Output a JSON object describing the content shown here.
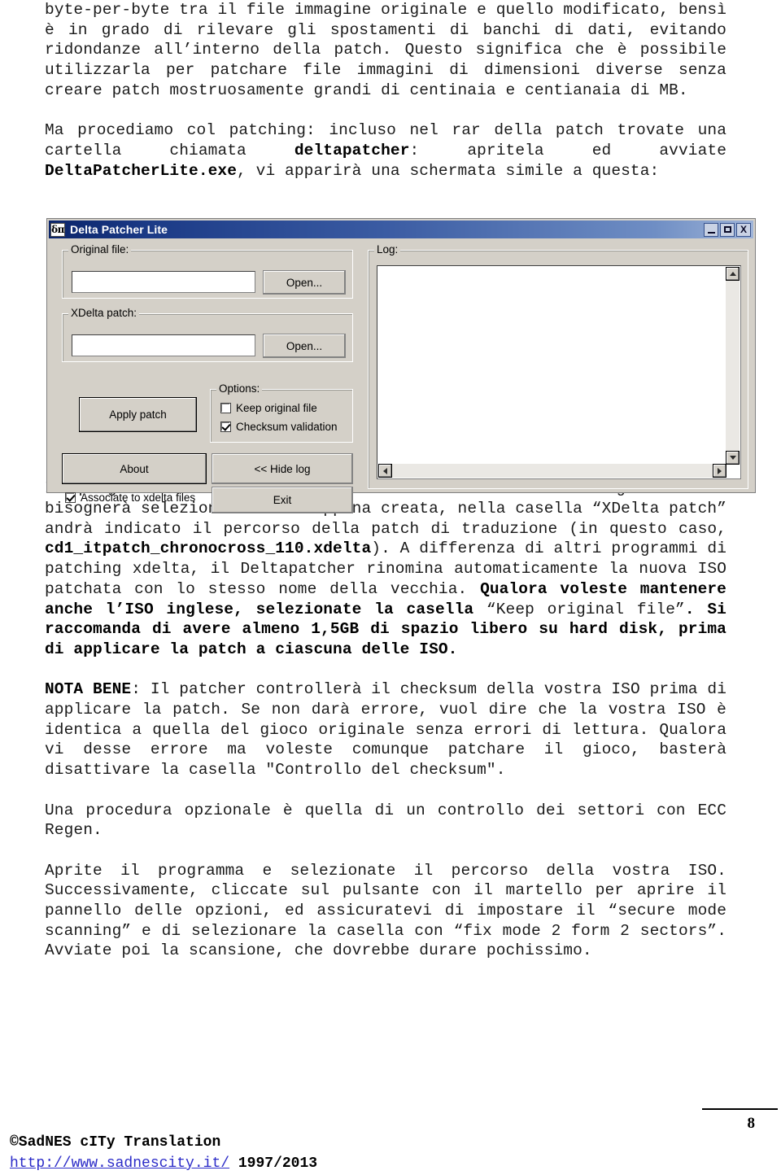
{
  "document": {
    "paragraphs": [
      {
        "id": "p1",
        "runs": [
          {
            "t": "byte-per-byte tra il file immagine originale e quello modificato, bensì è in grado di rilevare gli spostamenti di banchi di dati, evitando ridondanze all’interno della patch. Questo significa che è possibile utilizzarla per patchare file immagini di dimensioni diverse senza creare patch mostruosamente grandi di centinaia e centianaia di MB.",
            "b": false
          }
        ]
      },
      {
        "id": "p2",
        "runs": [
          {
            "t": "Ma procediamo col patching: incluso nel rar della patch trovate una cartella chiamata ",
            "b": false
          },
          {
            "t": "deltapatcher",
            "b": true
          },
          {
            "t": ": apritela ed avviate ",
            "b": false
          },
          {
            "t": "DeltaPatcherLite.exe",
            "b": true
          },
          {
            "t": ", vi apparirà una schermata simile a questa:",
            "b": false
          }
        ]
      },
      {
        "id": "p3",
        "runs": [
          {
            "t": "Il programma è decisamente intuitivo. Mella casella “Original File” bisognerà selezionare l’ISO appena creata, nella casella “XDelta patch” andrà indicato il percorso della patch di traduzione (in questo caso, ",
            "b": false
          },
          {
            "t": "cd1_itpatch_chronocross_110.xdelta",
            "b": true
          },
          {
            "t": "). A differenza di altri programmi di patching xdelta, il Deltapatcher rinomina automaticamente la nuova ISO patchata con lo stesso nome della vecchia. ",
            "b": false
          },
          {
            "t": "Qualora voleste mantenere anche l’ISO inglese, selezionate la casella ",
            "b": true
          },
          {
            "t": "“Keep original file”",
            "b": false
          },
          {
            "t": ". Si raccomanda di avere almeno 1,5GB di spazio libero su hard disk, prima di applicare la patch a ciascuna delle ISO.",
            "b": true
          }
        ]
      },
      {
        "id": "p4",
        "runs": [
          {
            "t": "NOTA BENE",
            "b": true
          },
          {
            "t": ": Il patcher controllerà il checksum della vostra ISO prima di applicare la patch. Se non darà errore, vuol dire che la vostra ISO è identica a quella del gioco originale senza errori di lettura. Qualora vi desse errore ma voleste comunque patchare il gioco, basterà disattivare la casella \"Controllo del checksum\".",
            "b": false
          }
        ]
      },
      {
        "id": "p5",
        "runs": [
          {
            "t": "Una procedura opzionale è quella di un controllo dei settori con ECC Regen.",
            "b": false
          }
        ]
      },
      {
        "id": "p6",
        "runs": [
          {
            "t": "Aprite il programma e selezionate il percorso della vostra ISO. Successivamente, cliccate sul pulsante con il martello per aprire il pannello delle opzioni, ed assicuratevi di impostare il “secure mode scanning” e di selezionare la casella con “fix mode 2 form 2 sectors”. Avviate poi la scansione, che dovrebbe durare pochissimo.",
            "b": false
          }
        ]
      }
    ]
  },
  "app": {
    "icon_glyph": "δπ",
    "title": "Delta Patcher Lite",
    "window_buttons": {
      "minimize_label": "_",
      "maximize_label": "□",
      "close_label": "X"
    },
    "groups": {
      "original_file_legend": "Original file:",
      "xdelta_patch_legend": "XDelta patch:",
      "options_legend": "Options:",
      "log_legend": "Log:"
    },
    "fields": {
      "original_file_value": "",
      "original_file_placeholder": "",
      "xdelta_patch_value": "",
      "xdelta_patch_placeholder": ""
    },
    "buttons": {
      "open_original": "Open...",
      "open_patch": "Open...",
      "apply_patch": "Apply patch",
      "about": "About",
      "hide_log": "<< Hide log",
      "exit": "Exit"
    },
    "checkboxes": {
      "keep_original_file": {
        "label": "Keep original file",
        "checked": false
      },
      "checksum_validation": {
        "label": "Checksum validation",
        "checked": true
      },
      "associate_to_xdelta": {
        "label": "Associate to xdelta files",
        "checked": true
      }
    },
    "log_text": "",
    "colors": {
      "titlebar_start": "#0a246a",
      "titlebar_end": "#9fb4d8",
      "face": "#d4d0c8",
      "field": "#ffffff"
    }
  },
  "footer": {
    "copyright": "©SadNES cITy Translation",
    "url": "http://www.sadnescity.it/",
    "years": "1997/2013",
    "page_number": "8"
  }
}
